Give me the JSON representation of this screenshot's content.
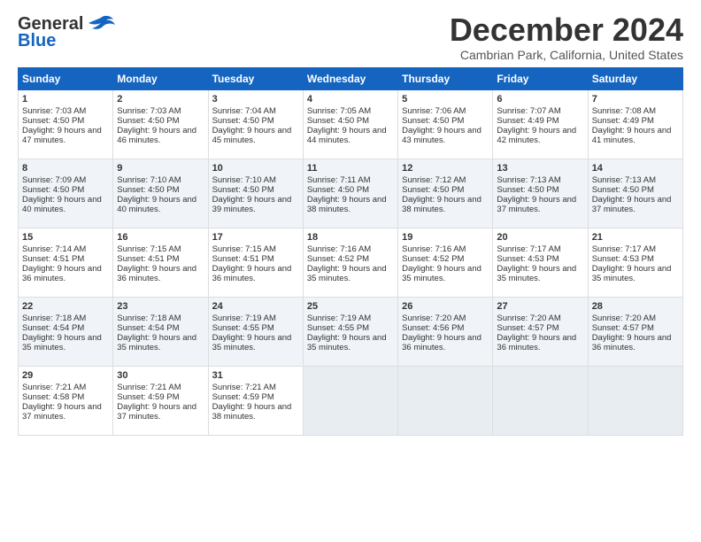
{
  "logo": {
    "line1": "General",
    "line2": "Blue"
  },
  "title": "December 2024",
  "location": "Cambrian Park, California, United States",
  "weekdays": [
    "Sunday",
    "Monday",
    "Tuesday",
    "Wednesday",
    "Thursday",
    "Friday",
    "Saturday"
  ],
  "weeks": [
    [
      {
        "day": "1",
        "sunrise": "7:03 AM",
        "sunset": "4:50 PM",
        "daylight": "9 hours and 47 minutes."
      },
      {
        "day": "2",
        "sunrise": "7:03 AM",
        "sunset": "4:50 PM",
        "daylight": "9 hours and 46 minutes."
      },
      {
        "day": "3",
        "sunrise": "7:04 AM",
        "sunset": "4:50 PM",
        "daylight": "9 hours and 45 minutes."
      },
      {
        "day": "4",
        "sunrise": "7:05 AM",
        "sunset": "4:50 PM",
        "daylight": "9 hours and 44 minutes."
      },
      {
        "day": "5",
        "sunrise": "7:06 AM",
        "sunset": "4:50 PM",
        "daylight": "9 hours and 43 minutes."
      },
      {
        "day": "6",
        "sunrise": "7:07 AM",
        "sunset": "4:49 PM",
        "daylight": "9 hours and 42 minutes."
      },
      {
        "day": "7",
        "sunrise": "7:08 AM",
        "sunset": "4:49 PM",
        "daylight": "9 hours and 41 minutes."
      }
    ],
    [
      {
        "day": "8",
        "sunrise": "7:09 AM",
        "sunset": "4:50 PM",
        "daylight": "9 hours and 40 minutes."
      },
      {
        "day": "9",
        "sunrise": "7:10 AM",
        "sunset": "4:50 PM",
        "daylight": "9 hours and 40 minutes."
      },
      {
        "day": "10",
        "sunrise": "7:10 AM",
        "sunset": "4:50 PM",
        "daylight": "9 hours and 39 minutes."
      },
      {
        "day": "11",
        "sunrise": "7:11 AM",
        "sunset": "4:50 PM",
        "daylight": "9 hours and 38 minutes."
      },
      {
        "day": "12",
        "sunrise": "7:12 AM",
        "sunset": "4:50 PM",
        "daylight": "9 hours and 38 minutes."
      },
      {
        "day": "13",
        "sunrise": "7:13 AM",
        "sunset": "4:50 PM",
        "daylight": "9 hours and 37 minutes."
      },
      {
        "day": "14",
        "sunrise": "7:13 AM",
        "sunset": "4:50 PM",
        "daylight": "9 hours and 37 minutes."
      }
    ],
    [
      {
        "day": "15",
        "sunrise": "7:14 AM",
        "sunset": "4:51 PM",
        "daylight": "9 hours and 36 minutes."
      },
      {
        "day": "16",
        "sunrise": "7:15 AM",
        "sunset": "4:51 PM",
        "daylight": "9 hours and 36 minutes."
      },
      {
        "day": "17",
        "sunrise": "7:15 AM",
        "sunset": "4:51 PM",
        "daylight": "9 hours and 36 minutes."
      },
      {
        "day": "18",
        "sunrise": "7:16 AM",
        "sunset": "4:52 PM",
        "daylight": "9 hours and 35 minutes."
      },
      {
        "day": "19",
        "sunrise": "7:16 AM",
        "sunset": "4:52 PM",
        "daylight": "9 hours and 35 minutes."
      },
      {
        "day": "20",
        "sunrise": "7:17 AM",
        "sunset": "4:53 PM",
        "daylight": "9 hours and 35 minutes."
      },
      {
        "day": "21",
        "sunrise": "7:17 AM",
        "sunset": "4:53 PM",
        "daylight": "9 hours and 35 minutes."
      }
    ],
    [
      {
        "day": "22",
        "sunrise": "7:18 AM",
        "sunset": "4:54 PM",
        "daylight": "9 hours and 35 minutes."
      },
      {
        "day": "23",
        "sunrise": "7:18 AM",
        "sunset": "4:54 PM",
        "daylight": "9 hours and 35 minutes."
      },
      {
        "day": "24",
        "sunrise": "7:19 AM",
        "sunset": "4:55 PM",
        "daylight": "9 hours and 35 minutes."
      },
      {
        "day": "25",
        "sunrise": "7:19 AM",
        "sunset": "4:55 PM",
        "daylight": "9 hours and 35 minutes."
      },
      {
        "day": "26",
        "sunrise": "7:20 AM",
        "sunset": "4:56 PM",
        "daylight": "9 hours and 36 minutes."
      },
      {
        "day": "27",
        "sunrise": "7:20 AM",
        "sunset": "4:57 PM",
        "daylight": "9 hours and 36 minutes."
      },
      {
        "day": "28",
        "sunrise": "7:20 AM",
        "sunset": "4:57 PM",
        "daylight": "9 hours and 36 minutes."
      }
    ],
    [
      {
        "day": "29",
        "sunrise": "7:21 AM",
        "sunset": "4:58 PM",
        "daylight": "9 hours and 37 minutes."
      },
      {
        "day": "30",
        "sunrise": "7:21 AM",
        "sunset": "4:59 PM",
        "daylight": "9 hours and 37 minutes."
      },
      {
        "day": "31",
        "sunrise": "7:21 AM",
        "sunset": "4:59 PM",
        "daylight": "9 hours and 38 minutes."
      },
      null,
      null,
      null,
      null
    ]
  ]
}
